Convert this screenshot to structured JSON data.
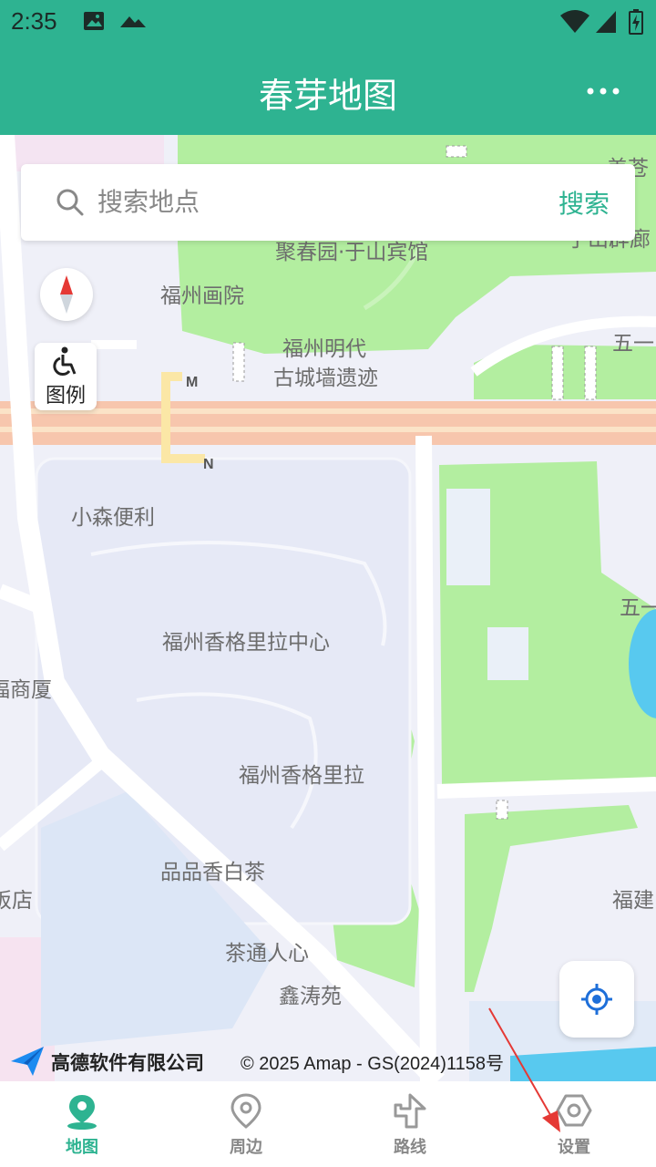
{
  "status_bar": {
    "time": "2:35",
    "icons": [
      "image-icon",
      "cloud-icon",
      "wifi-icon",
      "signal-icon",
      "battery-charging-icon"
    ]
  },
  "app_bar": {
    "title": "春芽地图",
    "menu_icon": "more-horizontal-icon"
  },
  "search": {
    "placeholder": "搜索地点",
    "value": "",
    "button_label": "搜索",
    "icon": "search-icon"
  },
  "map_controls": {
    "compass_icon": "compass-icon",
    "legend_icon": "accessibility-icon",
    "legend_label": "图例",
    "locate_icon": "locate-target-icon"
  },
  "map_labels": [
    "聚春园·于山宾馆",
    "福州画院",
    "福州明代",
    "古城墙遗迹",
    "五一",
    "小森便利",
    "福州香格里拉中心",
    "五一",
    "福商厦",
    "福州香格里拉",
    "品品香白茶",
    "饭店",
    "福建",
    "茶通人心",
    "鑫涛苑",
    "于山辟廊",
    "美苍",
    "M",
    "N"
  ],
  "attribution": {
    "brand": "高德软件有限公司",
    "copyright": "© 2025 Amap - GS(2024)1158号"
  },
  "tab_bar": {
    "tabs": [
      {
        "label": "地图",
        "icon": "map-pin-icon",
        "active": true
      },
      {
        "label": "周边",
        "icon": "location-pin-icon",
        "active": false
      },
      {
        "label": "路线",
        "icon": "route-turn-icon",
        "active": false
      },
      {
        "label": "设置",
        "icon": "settings-icon",
        "active": false
      }
    ]
  },
  "colors": {
    "accent": "#2eb391",
    "park": "#b3eea0",
    "road_major": "#f7c6ad",
    "water": "#58c9ef",
    "annotation_arrow": "#e53935"
  }
}
